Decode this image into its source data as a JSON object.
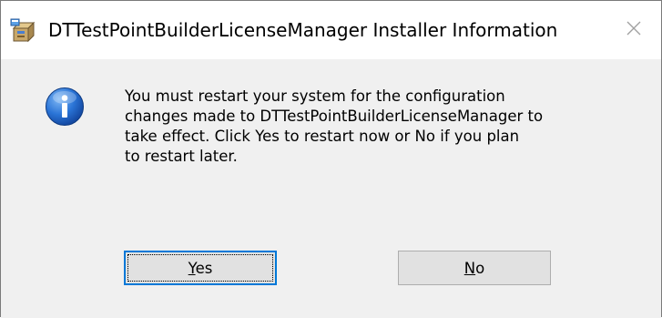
{
  "window": {
    "title": "DTTestPointBuilderLicenseManager Installer Information",
    "app_icon": "installer-package-icon",
    "close_icon": "close-icon"
  },
  "dialog": {
    "icon": "information-icon",
    "message": "You must restart your system for the configuration\nchanges made to DTTestPointBuilderLicenseManager to\ntake effect. Click Yes to restart now or No if you plan\nto restart later.",
    "buttons": {
      "yes": {
        "mnemonic": "Y",
        "rest": "es"
      },
      "no": {
        "mnemonic": "N",
        "rest": "o"
      }
    }
  },
  "colors": {
    "accent": "#0078d7",
    "info_blue": "#1e64c8"
  }
}
